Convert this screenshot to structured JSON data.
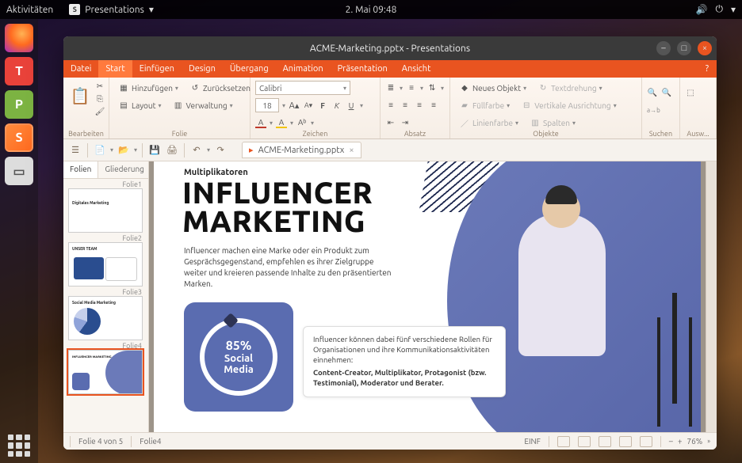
{
  "topbar": {
    "activities": "Aktivitäten",
    "app_indicator": "Presentations",
    "datetime": "2. Mai  09:48"
  },
  "window": {
    "title": "ACME-Marketing.pptx - Presentations"
  },
  "menubar": {
    "items": [
      "Datei",
      "Start",
      "Einfügen",
      "Design",
      "Übergang",
      "Animation",
      "Präsentation",
      "Ansicht"
    ],
    "active_index": 1
  },
  "ribbon": {
    "edit_group": "Bearbeiten",
    "slide_group": "Folie",
    "char_group": "Zeichen",
    "para_group": "Absatz",
    "objects_group": "Objekte",
    "search_group": "Suchen",
    "select_group": "Ausw...",
    "add_btn": "Hinzufügen",
    "layout_btn": "Layout",
    "reset_btn": "Zurücksetzen",
    "manage_btn": "Verwaltung",
    "font_name": "Calibri",
    "font_size": "18",
    "new_object": "Neues Objekt",
    "text_rotate": "Textdrehung",
    "fill_color": "Füllfarbe",
    "vert_align": "Vertikale Ausrichtung",
    "line_color": "Linienfarbe",
    "columns": "Spalten"
  },
  "doctab": {
    "label": "ACME-Marketing.pptx"
  },
  "sidepanel": {
    "tabs": [
      "Folien",
      "Gliederung"
    ],
    "thumbs": [
      {
        "label": "Folie1",
        "caption": "Digitales Marketing"
      },
      {
        "label": "Folie2",
        "caption": "UNSER TEAM"
      },
      {
        "label": "Folie3",
        "caption": "Social Media Marketing"
      },
      {
        "label": "Folie4",
        "caption": "INFLUENCER MARKETING"
      }
    ],
    "selected_index": 3
  },
  "slide": {
    "kicker": "Multiplikatoren",
    "title_line1": "INFLUENCER",
    "title_line2": "MARKETING",
    "desc": "Influencer machen eine Marke oder ein Produkt zum Gesprächsgegenstand, empfehlen es ihrer Zielgruppe weiter und kreieren passende Inhalte zu den präsentierten Marken.",
    "badge_percent": "85%",
    "badge_label1": "Social",
    "badge_label2": "Media",
    "callout_intro": "Influencer können dabei fünf verschiedene Rollen für Organisationen und ihre Kommunikationsaktivitäten einnehmen:",
    "callout_bold": "Content-Creator, Multiplikator, Protagonist (bzw. Testimonial), Moderator und Berater."
  },
  "statusbar": {
    "counter": "Folie 4 von 5",
    "name": "Folie4",
    "insert_mode": "EINF",
    "zoom": "76%"
  }
}
